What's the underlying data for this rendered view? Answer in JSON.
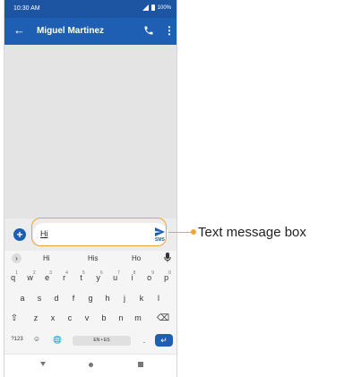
{
  "status_bar": {
    "time": "10:30 AM",
    "battery": "100%"
  },
  "app_bar": {
    "back_icon": "←",
    "contact_name": "Miguel Martinez",
    "more_icon": "⋮"
  },
  "composer": {
    "add_icon": "+",
    "message_text": "Hi",
    "send_sub_label": "SMS"
  },
  "callout": {
    "label": "Text message box"
  },
  "keyboard": {
    "expand_icon": "›",
    "suggestions": [
      "Hi",
      "His",
      "Ho"
    ],
    "row1": [
      {
        "k": "q",
        "n": "1"
      },
      {
        "k": "w",
        "n": "2"
      },
      {
        "k": "e",
        "n": "3"
      },
      {
        "k": "r",
        "n": "4"
      },
      {
        "k": "t",
        "n": "5"
      },
      {
        "k": "y",
        "n": "6"
      },
      {
        "k": "u",
        "n": "7"
      },
      {
        "k": "i",
        "n": "8"
      },
      {
        "k": "o",
        "n": "9"
      },
      {
        "k": "p",
        "n": "0"
      }
    ],
    "row2": [
      "a",
      "s",
      "d",
      "f",
      "g",
      "h",
      "j",
      "k",
      "l"
    ],
    "row3": [
      "⇧",
      "z",
      "x",
      "c",
      "v",
      "b",
      "n",
      "m",
      "⌫"
    ],
    "symbols_key": "?123",
    "emoji_key": "☺",
    "globe_key": "🌐",
    "space_label": "EN • ES",
    "period_key": ".",
    "enter_icon": "↵"
  },
  "colors": {
    "accent": "#1e5fb4",
    "status_bar": "#1e55a3",
    "callout": "#f0a53a"
  }
}
